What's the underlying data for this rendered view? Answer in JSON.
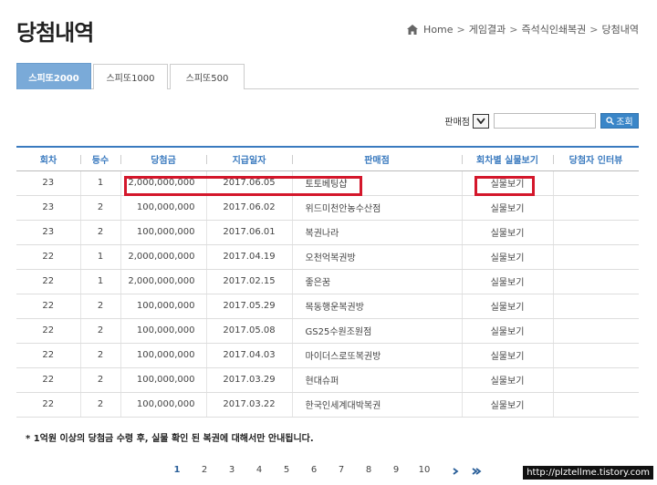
{
  "page": {
    "title": "당첨내역"
  },
  "breadcrumb": [
    "Home",
    "게임결과",
    "즉석식인쇄복권",
    "당첨내역"
  ],
  "tabs": [
    {
      "label": "스피또2000",
      "active": true
    },
    {
      "label": "스피또1000",
      "active": false
    },
    {
      "label": "스피또500",
      "active": false
    }
  ],
  "search": {
    "label": "판매점",
    "input_value": "",
    "button_label": "조회"
  },
  "table": {
    "headers": [
      "회차",
      "등수",
      "당첨금",
      "지급일자",
      "판매점",
      "회차별 실물보기",
      "당첨자 인터뷰"
    ],
    "rows": [
      {
        "round": "23",
        "rank": "1",
        "amount": "2,000,000,000",
        "date": "2017.06.05",
        "shop": "토토베팅샵",
        "view": "실물보기",
        "interview": ""
      },
      {
        "round": "23",
        "rank": "2",
        "amount": "100,000,000",
        "date": "2017.06.02",
        "shop": "위드미천안농수산점",
        "view": "실물보기",
        "interview": ""
      },
      {
        "round": "23",
        "rank": "2",
        "amount": "100,000,000",
        "date": "2017.06.01",
        "shop": "복권나라",
        "view": "실물보기",
        "interview": ""
      },
      {
        "round": "22",
        "rank": "1",
        "amount": "2,000,000,000",
        "date": "2017.04.19",
        "shop": "오천억복권방",
        "view": "실물보기",
        "interview": ""
      },
      {
        "round": "22",
        "rank": "1",
        "amount": "2,000,000,000",
        "date": "2017.02.15",
        "shop": "좋은꿈",
        "view": "실물보기",
        "interview": ""
      },
      {
        "round": "22",
        "rank": "2",
        "amount": "100,000,000",
        "date": "2017.05.29",
        "shop": "목동행운복권방",
        "view": "실물보기",
        "interview": ""
      },
      {
        "round": "22",
        "rank": "2",
        "amount": "100,000,000",
        "date": "2017.05.08",
        "shop": "GS25수원조원점",
        "view": "실물보기",
        "interview": ""
      },
      {
        "round": "22",
        "rank": "2",
        "amount": "100,000,000",
        "date": "2017.04.03",
        "shop": "마이더스로또복권방",
        "view": "실물보기",
        "interview": ""
      },
      {
        "round": "22",
        "rank": "2",
        "amount": "100,000,000",
        "date": "2017.03.29",
        "shop": "현대슈퍼",
        "view": "실물보기",
        "interview": ""
      },
      {
        "round": "22",
        "rank": "2",
        "amount": "100,000,000",
        "date": "2017.03.22",
        "shop": "한국인세계대박복권",
        "view": "실물보기",
        "interview": ""
      }
    ]
  },
  "footnote": "* 1억원 이상의 당첨금 수령 후, 실물 확인 된 복권에 대해서만 안내됩니다.",
  "pagination": {
    "pages": [
      "1",
      "2",
      "3",
      "4",
      "5",
      "6",
      "7",
      "8",
      "9",
      "10"
    ],
    "current": "1"
  },
  "watermark": "http://plztellme.tistory.com",
  "colors": {
    "accent": "#3a7abf",
    "tab_active": "#7aaad8",
    "highlight": "#d4172b"
  },
  "icons": {
    "home": "home-icon",
    "dropdown": "chevron-down-icon",
    "search": "search-icon",
    "next": "chevron-right-icon",
    "last": "double-chevron-right-icon"
  }
}
